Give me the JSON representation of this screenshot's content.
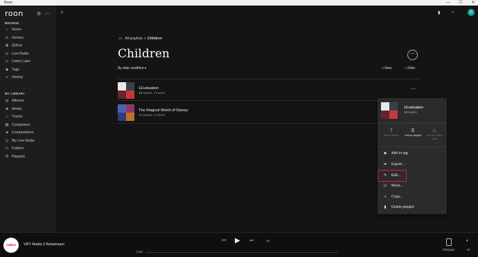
{
  "window": {
    "title": "Roon",
    "min": "—",
    "max": "☐",
    "close": "✕"
  },
  "sidebar": {
    "logo": "roon",
    "browse_title": "BROWSE",
    "browse": [
      {
        "label": "Home",
        "icon": "home-icon",
        "glyph": "⌂"
      },
      {
        "label": "Genres",
        "icon": "genres-icon",
        "glyph": "≋"
      },
      {
        "label": "Qobuz",
        "icon": "qobuz-icon",
        "glyph": "◉"
      },
      {
        "label": "Live Radio",
        "icon": "radio-icon",
        "glyph": "◎"
      },
      {
        "label": "Listen Later",
        "icon": "bookmark-icon",
        "glyph": "▭"
      },
      {
        "label": "Tags",
        "icon": "tag-icon",
        "glyph": "◆"
      },
      {
        "label": "History",
        "icon": "history-icon",
        "glyph": "≡"
      }
    ],
    "library_title": "MY LIBRARY",
    "library": [
      {
        "label": "Albums",
        "icon": "albums-icon",
        "glyph": "◍"
      },
      {
        "label": "Artists",
        "icon": "artists-icon",
        "glyph": "☻"
      },
      {
        "label": "Tracks",
        "icon": "tracks-icon",
        "glyph": "♫"
      },
      {
        "label": "Composers",
        "icon": "composers-icon",
        "glyph": "▦"
      },
      {
        "label": "Compositions",
        "icon": "compositions-icon",
        "glyph": "◈"
      },
      {
        "label": "My Live Radio",
        "icon": "live-radio-icon",
        "glyph": "◎"
      },
      {
        "label": "Folders",
        "icon": "folder-icon",
        "glyph": "▭"
      },
      {
        "label": "Playlists",
        "icon": "playlist-icon",
        "glyph": "≣"
      }
    ]
  },
  "main": {
    "breadcrumb": {
      "parent": "All playlists",
      "sep": ">",
      "current": "Children"
    },
    "title": "Children",
    "sort_label": "By date modified ▾",
    "new_label": "+ New",
    "filter_label": "Filter",
    "playlists": [
      {
        "name": "1Evaluation",
        "meta": "39 tracks, 4 hours"
      },
      {
        "name": "The Magical World of Disney",
        "meta": "71 tracks, 4 hours"
      }
    ]
  },
  "context_menu": {
    "name": "1Evaluation",
    "meta": "39 tracks",
    "actions": [
      {
        "label": "Add to library",
        "icon": "library-icon",
        "glyph": "⫼",
        "enabled": false
      },
      {
        "label": "Add to playlist",
        "icon": "add-playlist-icon",
        "glyph": "☰",
        "enabled": true
      },
      {
        "label": "Add to Listen Later",
        "icon": "listen-later-icon",
        "glyph": "◷",
        "enabled": false
      }
    ],
    "items": [
      {
        "label": "Add to tag",
        "icon": "tag-icon",
        "glyph": "◆"
      },
      {
        "label": "Export...",
        "icon": "export-icon",
        "glyph": "➦"
      },
      {
        "label": "Edit...",
        "icon": "pencil-icon",
        "glyph": "✎"
      },
      {
        "label": "Move...",
        "icon": "folder-icon",
        "glyph": "▭"
      },
      {
        "label": "Copy...",
        "icon": "plus-icon",
        "glyph": "+"
      },
      {
        "label": "Delete playlist",
        "icon": "trash-icon",
        "glyph": "▮"
      }
    ],
    "highlight_color": "#e0107e"
  },
  "player": {
    "station_logo": "radio2",
    "station": "VRT Radio 2 Antwerpen",
    "time": "0:00",
    "zone": "Thinkpad",
    "volume": "97"
  }
}
